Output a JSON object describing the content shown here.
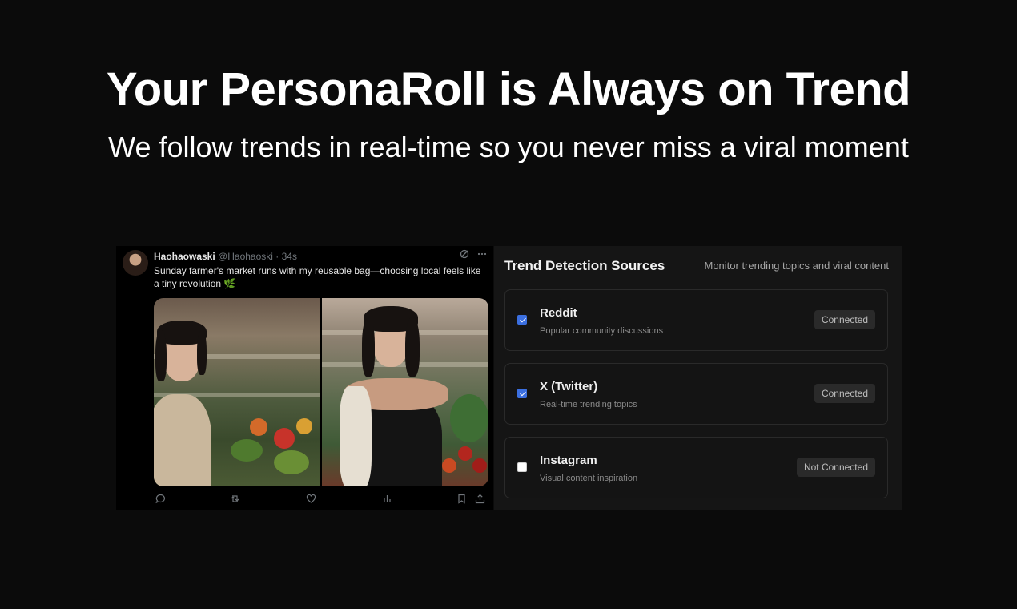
{
  "hero": {
    "title": "Your PersonaRoll is Always on Trend",
    "subtitle": "We follow trends in real-time so you never miss a viral moment"
  },
  "tweet": {
    "author_name": "Haohaowaski",
    "meta": "@Haohaoski · 34s",
    "text": "Sunday farmer's market runs with my reusable bag—choosing local feels like a tiny revolution 🌿",
    "header_icons": [
      "grok-icon",
      "more-icon"
    ],
    "actions": [
      "reply-icon",
      "retweet-icon",
      "like-icon",
      "views-icon",
      "bookmark-icon",
      "share-icon"
    ]
  },
  "panel": {
    "title": "Trend Detection Sources",
    "description": "Monitor trending topics and viral content",
    "sources": [
      {
        "name": "Reddit",
        "description": "Popular community discussions",
        "checked": true,
        "status": "Connected"
      },
      {
        "name": "X (Twitter)",
        "description": "Real-time trending topics",
        "checked": true,
        "status": "Connected"
      },
      {
        "name": "Instagram",
        "description": "Visual content inspiration",
        "checked": false,
        "status": "Not Connected"
      }
    ]
  },
  "colors": {
    "background": "#0b0b0b",
    "panel": "#151515",
    "checkbox_accent": "#3b6fe0"
  }
}
